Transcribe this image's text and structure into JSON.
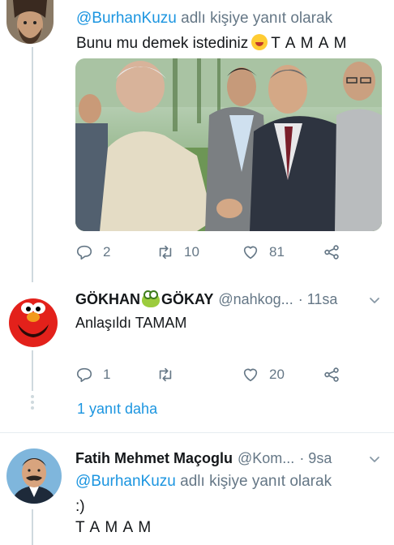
{
  "tweet1": {
    "reply_prefix_handle": "@BurhanKuzu",
    "reply_suffix": "adlı kişiye yanıt olarak",
    "text_before": "Bunu mu demek istediniz",
    "emoji": "laughing-face",
    "text_after": "T A M A M",
    "actions": {
      "replies": "2",
      "retweets": "10",
      "likes": "81"
    }
  },
  "tweet2": {
    "name_part1": "GÖKHAN",
    "name_emoji": "frog-face",
    "name_part2": "GÖKAY",
    "handle": "@nahkog...",
    "time": "· 11sa",
    "text": "Anlaşıldı TAMAM",
    "actions": {
      "replies": "1",
      "retweets": "",
      "likes": "20"
    },
    "more_replies": "1 yanıt daha"
  },
  "tweet3": {
    "name": "Fatih Mehmet Maçoglu",
    "handle": "@Kom...",
    "time": "· 9sa",
    "reply_prefix_handle": "@BurhanKuzu",
    "reply_suffix": "adlı kişiye yanıt olarak",
    "text_line1": ":)",
    "text_line2": "T A M A M"
  },
  "colors": {
    "link": "#1b95e0",
    "muted": "#657786",
    "divider": "#e6ecf0"
  }
}
